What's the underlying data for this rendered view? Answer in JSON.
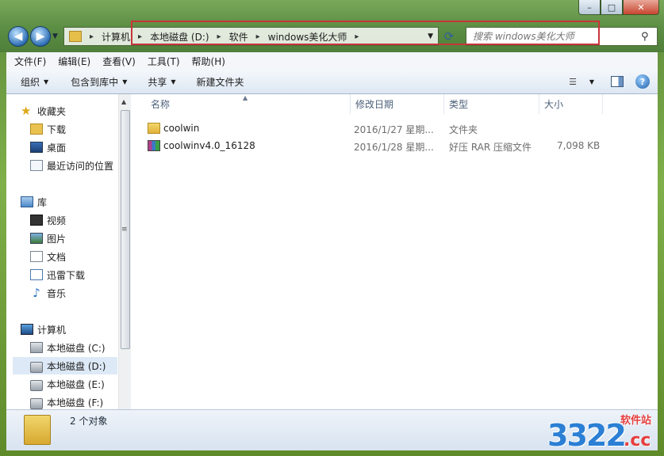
{
  "window": {
    "caption": {
      "minimize": "–",
      "maximize": "□",
      "close": "✕"
    }
  },
  "address": {
    "crumbs": [
      "计算机",
      "本地磁盘 (D:)",
      "软件",
      "windows美化大师"
    ]
  },
  "search": {
    "placeholder": "搜索 windows美化大师"
  },
  "menu": [
    "文件(F)",
    "编辑(E)",
    "查看(V)",
    "工具(T)",
    "帮助(H)"
  ],
  "toolbar": {
    "organize": "组织",
    "include": "包含到库中",
    "share": "共享",
    "new_folder": "新建文件夹"
  },
  "sidebar": {
    "favorites": "收藏夹",
    "downloads": "下载",
    "desktop": "桌面",
    "recent": "最近访问的位置",
    "libraries": "库",
    "videos": "视频",
    "pictures": "图片",
    "documents": "文档",
    "xunlei": "迅雷下载",
    "music": "音乐",
    "computer": "计算机",
    "drive_c": "本地磁盘 (C:)",
    "drive_d": "本地磁盘 (D:)",
    "drive_e": "本地磁盘 (E:)",
    "drive_f": "本地磁盘 (F:)"
  },
  "columns": {
    "name": "名称",
    "date": "修改日期",
    "type": "类型",
    "size": "大小"
  },
  "files": [
    {
      "name": "coolwin",
      "date": "2016/1/27 星期...",
      "type": "文件夹",
      "size": ""
    },
    {
      "name": "coolwinv4.0_16128",
      "date": "2016/1/28 星期...",
      "type": "好压 RAR 压缩文件",
      "size": "7,098 KB"
    }
  ],
  "status": {
    "text": "2 个对象"
  },
  "watermark": {
    "digits": "3322",
    "suffix": ".cc",
    "label": "软件站"
  },
  "colors": {
    "highlight": "#c8353a",
    "selected": "#dde9f6",
    "accent": "#2f6fb5"
  }
}
